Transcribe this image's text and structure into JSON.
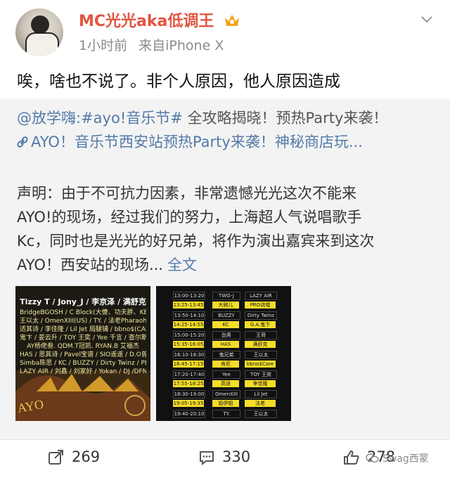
{
  "post": {
    "username": "MC光光aka低调王",
    "time": "1小时前",
    "source": "来自iPhone X",
    "text": "唉，啥也不说了。非个人原因，他人原因造成"
  },
  "repost": {
    "author": "@放学嗨",
    "topic": ":#ayo!音乐节#",
    "headline": " 全攻略揭晓！预热Party来袭！",
    "link_text": "AYO！音乐节西安站预热Party来袭！神秘商店玩...",
    "statement_lines": [
      "声明：由于不可抗力因素，非常遗憾光光这次不能来",
      "AYO!的现场，经过我们的努力，上海超人气说唱歌手",
      "Kc，同时也是光光的好兄弟，将作为演出嘉宾来到这次",
      "AYO！西安站的现场..."
    ],
    "full_text": "全文",
    "poster": {
      "artist_lines": [
        "Tizzy T / Jony_J / 李京泽 / 满舒克",
        "BridgeBGOSH / C Block(大傻、功夫胖、KEY.L)",
        "王以太 / OmenXIII(US) / TY. / 法老Pharaoh",
        "适其诗 / 李佳隆 / Lil Jet 局腿铺 / bbno$(CAN)",
        "鬼卞 / 姜云升 / TOY 王奕 / Yee 千言 / 查尔斯",
        "AY杨佬叁. QDM.T冠凯. RYAN.B 艾福杰",
        "HAS / 思其诗 / Pavel宝谱 / SIO遥遥 / D.O曾玺",
        "Simba陈思 / KC / BUZZY / Dirty Twinz / PRO说唱",
        "LAZY AIR / 刘鑫 / 刘家好 / Yokan / DJ /DFN"
      ]
    },
    "schedule": [
      {
        "time": "13:00-13:20",
        "a": "TWO-J",
        "b": "LAZY AIR",
        "hl": false
      },
      {
        "time": "13:25-13:45",
        "a": "大碗儿",
        "b": "PRO说唱",
        "hl": true
      },
      {
        "time": "13:50-14:10",
        "a": "BUZZY",
        "b": "Dirty Twinz",
        "hl": false
      },
      {
        "time": "14:25-14:55",
        "a": "KC",
        "b": "G.A.鬼卞",
        "hl": true
      },
      {
        "time": "15:00-15:20",
        "a": "劲男",
        "b": "王哥",
        "hl": false
      },
      {
        "time": "15:35-16:05",
        "a": "HAS",
        "b": "满舒克",
        "hl": true
      },
      {
        "time": "16:10-16:30",
        "a": "鬼兄弟",
        "b": "王以太",
        "hl": false
      },
      {
        "time": "16:45-17:15",
        "a": "肯尼",
        "b": "bbno$Care",
        "hl": true
      },
      {
        "time": "17:20-17:40",
        "a": "Yee",
        "b": "TOY 王奕",
        "hl": false
      },
      {
        "time": "17:55-18:25",
        "a": "高适",
        "b": "李佳隆",
        "hl": true
      },
      {
        "time": "18:30-19:00",
        "a": "OmenXIII",
        "b": "Lil Jet",
        "hl": false
      },
      {
        "time": "19:05-19:35",
        "a": "姐伊姐",
        "b": "法老",
        "hl": true
      },
      {
        "time": "19:40-20:10",
        "a": "TY.",
        "b": "王以太",
        "hl": false
      }
    ]
  },
  "actions": {
    "repost_count": "269",
    "comment_count": "330",
    "like_count": "278"
  },
  "watermark": "Swag西蒙"
}
